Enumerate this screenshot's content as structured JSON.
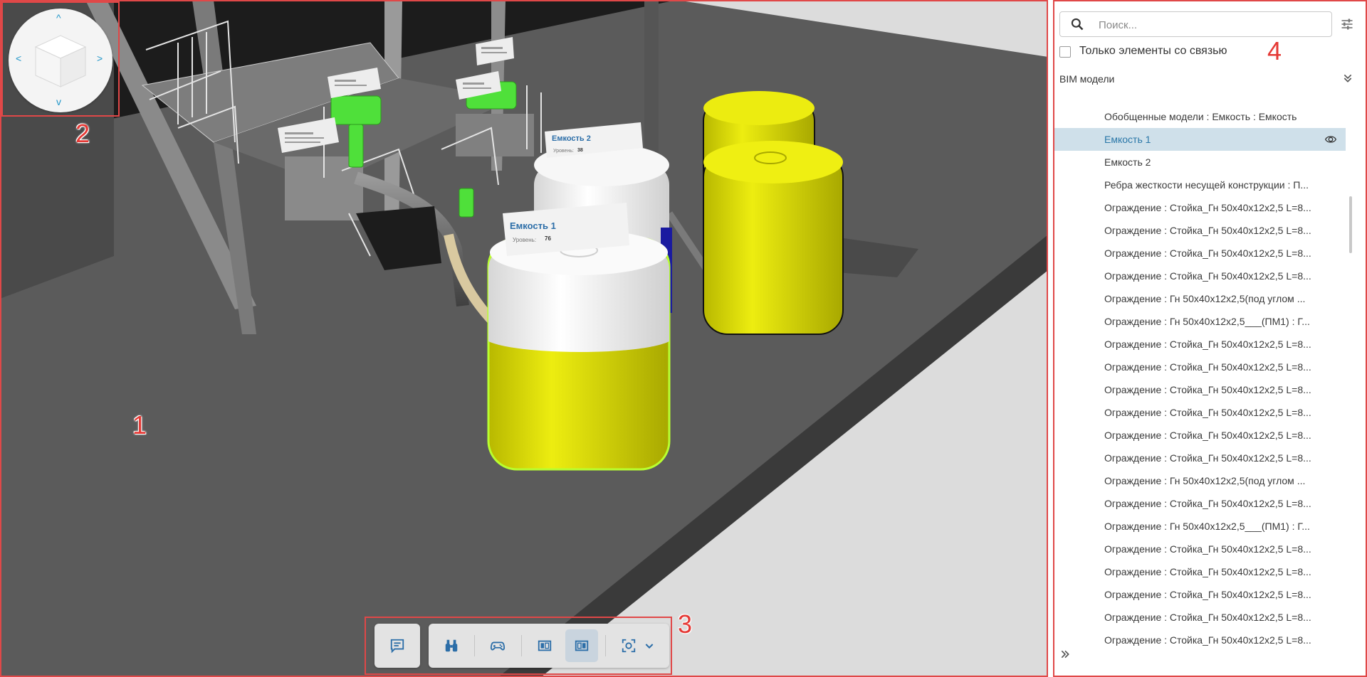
{
  "viewport": {
    "labels": [
      {
        "title": "Емкость 1",
        "line": "Уровень:",
        "value": "76"
      },
      {
        "title": "Емкость 2",
        "line": "Уровень:",
        "value": "38"
      }
    ],
    "colors": {
      "tank_yellow": "#e4e400",
      "tank_white": "#f2f2f2",
      "pump_green": "#4fe03a",
      "floor": "#595959",
      "label_blue": "#2c6ea8"
    }
  },
  "nav_cube": {
    "arrows": {
      "up": "^",
      "down": "v",
      "left": "<",
      "right": ">"
    },
    "icon": "navigation-cube-icon"
  },
  "toolbar": {
    "groups": [
      {
        "buttons": [
          {
            "icon": "comments-icon",
            "active": false
          }
        ]
      },
      {
        "buttons": [
          {
            "icon": "binoculars-icon",
            "active": false
          },
          {
            "icon": "gamepad-icon",
            "active": false
          },
          {
            "icon": "panel-left-icon",
            "active": false
          },
          {
            "icon": "panel-right-icon",
            "active": true
          },
          {
            "icon": "focus-frame-icon",
            "active": false
          },
          {
            "icon": "chevron-down-icon",
            "active": false
          }
        ]
      }
    ]
  },
  "panel": {
    "search_placeholder": "Поиск...",
    "linked_only_label": "Только элементы со связью",
    "section_title": "BIM модели",
    "items": [
      {
        "label": "Обобщенные модели : Емкость : Емкость",
        "selected": false
      },
      {
        "label": "Емкость 1",
        "selected": true
      },
      {
        "label": "Емкость 2",
        "selected": false
      },
      {
        "label": "Ребра жесткости несущей конструкции : П...",
        "selected": false
      },
      {
        "label": "Ограждение : Стойка_Гн  50х40х12х2,5 L=8...",
        "selected": false
      },
      {
        "label": "Ограждение : Стойка_Гн  50х40х12х2,5 L=8...",
        "selected": false
      },
      {
        "label": "Ограждение : Стойка_Гн  50х40х12х2,5 L=8...",
        "selected": false
      },
      {
        "label": "Ограждение : Стойка_Гн  50х40х12х2,5 L=8...",
        "selected": false
      },
      {
        "label": "Ограждение : Гн  50х40х12х2,5(под углом ...",
        "selected": false
      },
      {
        "label": "Ограждение : Гн  50х40х12х2,5___(ПМ1) : Г...",
        "selected": false
      },
      {
        "label": "Ограждение : Стойка_Гн  50х40х12х2,5 L=8...",
        "selected": false
      },
      {
        "label": "Ограждение : Стойка_Гн  50х40х12х2,5 L=8...",
        "selected": false
      },
      {
        "label": "Ограждение : Стойка_Гн  50х40х12х2,5 L=8...",
        "selected": false
      },
      {
        "label": "Ограждение : Стойка_Гн  50х40х12х2,5 L=8...",
        "selected": false
      },
      {
        "label": "Ограждение : Стойка_Гн  50х40х12х2,5 L=8...",
        "selected": false
      },
      {
        "label": "Ограждение : Стойка_Гн  50х40х12х2,5 L=8...",
        "selected": false
      },
      {
        "label": "Ограждение : Гн  50х40х12х2,5(под углом ...",
        "selected": false
      },
      {
        "label": "Ограждение : Стойка_Гн  50х40х12х2,5 L=8...",
        "selected": false
      },
      {
        "label": "Ограждение : Гн  50х40х12х2,5___(ПМ1) : Г...",
        "selected": false
      },
      {
        "label": "Ограждение : Стойка_Гн  50х40х12х2,5 L=8...",
        "selected": false
      },
      {
        "label": "Ограждение : Стойка_Гн  50х40х12х2,5 L=8...",
        "selected": false
      },
      {
        "label": "Ограждение : Стойка_Гн  50х40х12х2,5 L=8...",
        "selected": false
      },
      {
        "label": "Ограждение : Стойка_Гн  50х40х12х2,5 L=8...",
        "selected": false
      },
      {
        "label": "Ограждение : Стойка_Гн  50х40х12х2,5 L=8...",
        "selected": false
      }
    ],
    "expand_icon": "double-chevron-right-icon",
    "collapse_icon": "double-chevron-down-icon",
    "filter_icon": "filter-settings-icon"
  },
  "annotations": [
    "1",
    "2",
    "3",
    "4"
  ]
}
